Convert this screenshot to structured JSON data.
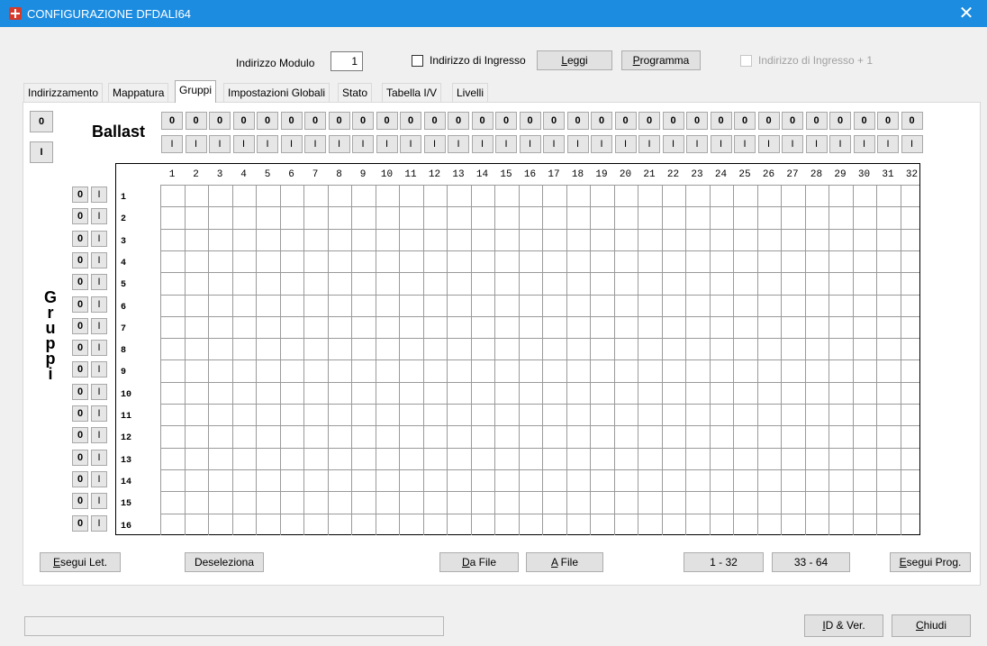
{
  "window": {
    "title": "CONFIGURAZIONE DFDALI64",
    "close_glyph": "✕"
  },
  "header": {
    "module_label": "Indirizzo Modulo",
    "module_value": "1",
    "input_address_label": "Indirizzo di Ingresso",
    "read_button": "Leggi",
    "program_button": "Programma",
    "input_address_plus_label": "Indirizzo di Ingresso + 1"
  },
  "tabs": [
    "Indirizzamento",
    "Mappatura",
    "Gruppi",
    "Impostazioni Globali",
    "Stato",
    "Tabella I/V",
    "Livelli"
  ],
  "active_tab": "Gruppi",
  "gruppi": {
    "ballast_label": "Ballast",
    "groups_label": [
      "G",
      "r",
      "u",
      "p",
      "p",
      "i"
    ],
    "all_off_label": "0",
    "all_on_label": "I",
    "ballast_off_label": "0",
    "ballast_on_label": "I",
    "group_off_label": "0",
    "group_on_label": "I",
    "ballast_columns": [
      "1",
      "2",
      "3",
      "4",
      "5",
      "6",
      "7",
      "8",
      "9",
      "10",
      "11",
      "12",
      "13",
      "14",
      "15",
      "16",
      "17",
      "18",
      "19",
      "20",
      "21",
      "22",
      "23",
      "24",
      "25",
      "26",
      "27",
      "28",
      "29",
      "30",
      "31",
      "32"
    ],
    "group_rows": [
      "1",
      "2",
      "3",
      "4",
      "5",
      "6",
      "7",
      "8",
      "9",
      "10",
      "11",
      "12",
      "13",
      "14",
      "15",
      "16"
    ]
  },
  "panel_buttons": {
    "execute_read": "Esegui Let.",
    "deselect": "Deseleziona",
    "from_file": "Da File",
    "to_file": "A File",
    "range_1_32": "1 - 32",
    "range_33_64": "33 - 64",
    "execute_prog": "Esegui Prog."
  },
  "footer": {
    "status_text": "",
    "id_ver_button": "ID & Ver.",
    "close_button": "Chiudi"
  }
}
